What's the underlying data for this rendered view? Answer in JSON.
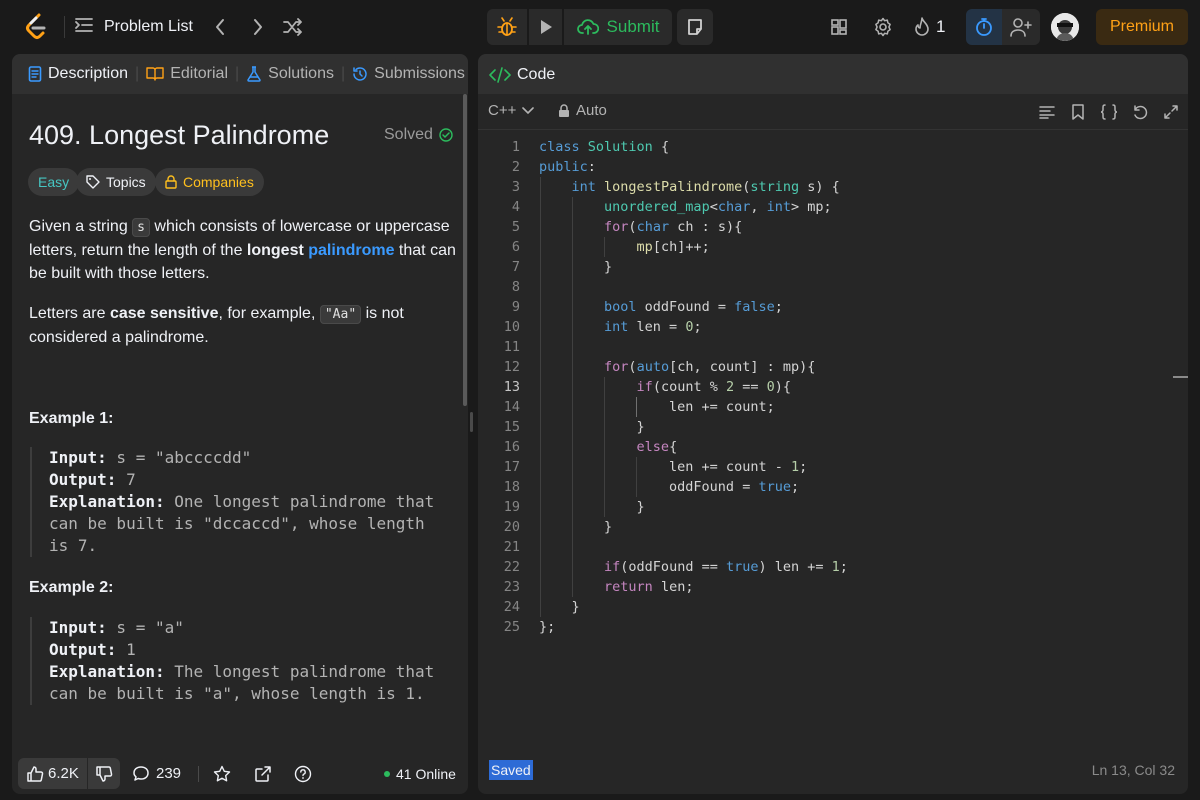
{
  "topbar": {
    "problem_list_label": "Problem List",
    "submit_label": "Submit",
    "streak_count": "1",
    "premium_label": "Premium"
  },
  "left_tabs": [
    "Description",
    "Editorial",
    "Solutions",
    "Submissions"
  ],
  "problem": {
    "title": "409. Longest Palindrome",
    "status": "Solved",
    "difficulty": "Easy",
    "topics_label": "Topics",
    "companies_label": "Companies",
    "para1": {
      "a": "Given a string ",
      "code": "s",
      "b": " which consists of lowercase or uppercase letters, return the length of the ",
      "bold": "longest",
      "link": "palindrome",
      "c": " that can be built with those letters."
    },
    "para2": {
      "a": "Letters are ",
      "bold": "case sensitive",
      "b": ", for example, ",
      "code": "\"Aa\"",
      "c": " is not considered a palindrome."
    },
    "examples": [
      {
        "heading": "Example 1:",
        "input_label": "Input:",
        "input": " s = \"abccccdd\"",
        "output_label": "Output:",
        "output": " 7",
        "explanation_label": "Explanation:",
        "explanation": " One longest palindrome that can be built is \"dccaccd\", whose length is 7."
      },
      {
        "heading": "Example 2:",
        "input_label": "Input:",
        "input": " s = \"a\"",
        "output_label": "Output:",
        "output": " 1",
        "explanation_label": "Explanation:",
        "explanation": " The longest palindrome that can be built is \"a\", whose length is 1."
      }
    ]
  },
  "footer": {
    "likes": "6.2K",
    "comments": "239",
    "online": "41 Online"
  },
  "editor": {
    "panel_title": "Code",
    "language": "C++",
    "mode": "Auto",
    "current_line": 13,
    "lines": [
      [
        [
          "kw",
          "class"
        ],
        [
          "t",
          " "
        ],
        [
          "type",
          "Solution"
        ],
        [
          "t",
          " {"
        ]
      ],
      [
        [
          "kw",
          "public"
        ],
        [
          "t",
          ":"
        ]
      ],
      [
        [
          "t",
          "    "
        ],
        [
          "kw",
          "int"
        ],
        [
          "t",
          " "
        ],
        [
          "fn",
          "longestPalindrome"
        ],
        [
          "t",
          "("
        ],
        [
          "type",
          "string"
        ],
        [
          "t",
          " s) {"
        ]
      ],
      [
        [
          "t",
          "        "
        ],
        [
          "type",
          "unordered_map"
        ],
        [
          "t",
          "<"
        ],
        [
          "kw",
          "char"
        ],
        [
          "t",
          ", "
        ],
        [
          "kw",
          "int"
        ],
        [
          "t",
          "> mp;"
        ]
      ],
      [
        [
          "t",
          "        "
        ],
        [
          "ctl",
          "for"
        ],
        [
          "t",
          "("
        ],
        [
          "kw",
          "char"
        ],
        [
          "t",
          " ch : s){"
        ]
      ],
      [
        [
          "t",
          "            "
        ],
        [
          "fn",
          "mp"
        ],
        [
          "t",
          "[ch]++;"
        ]
      ],
      [
        [
          "t",
          "        }"
        ]
      ],
      [
        [
          "t",
          ""
        ]
      ],
      [
        [
          "t",
          "        "
        ],
        [
          "kw",
          "bool"
        ],
        [
          "t",
          " oddFound = "
        ],
        [
          "kw",
          "false"
        ],
        [
          "t",
          ";"
        ]
      ],
      [
        [
          "t",
          "        "
        ],
        [
          "kw",
          "int"
        ],
        [
          "t",
          " len = "
        ],
        [
          "num",
          "0"
        ],
        [
          "t",
          ";"
        ]
      ],
      [
        [
          "t",
          ""
        ]
      ],
      [
        [
          "t",
          "        "
        ],
        [
          "ctl",
          "for"
        ],
        [
          "t",
          "("
        ],
        [
          "kw",
          "auto"
        ],
        [
          "t",
          "[ch, count] : mp){"
        ]
      ],
      [
        [
          "t",
          "            "
        ],
        [
          "ctl",
          "if"
        ],
        [
          "t",
          "(count % "
        ],
        [
          "num",
          "2"
        ],
        [
          "t",
          " == "
        ],
        [
          "num",
          "0"
        ],
        [
          "t",
          "){"
        ]
      ],
      [
        [
          "t",
          "                len += count;"
        ]
      ],
      [
        [
          "t",
          "            }"
        ]
      ],
      [
        [
          "t",
          "            "
        ],
        [
          "ctl",
          "else"
        ],
        [
          "t",
          "{"
        ]
      ],
      [
        [
          "t",
          "                len += count - "
        ],
        [
          "num",
          "1"
        ],
        [
          "t",
          ";"
        ]
      ],
      [
        [
          "t",
          "                oddFound = "
        ],
        [
          "kw",
          "true"
        ],
        [
          "t",
          ";"
        ]
      ],
      [
        [
          "t",
          "            }"
        ]
      ],
      [
        [
          "t",
          "        }"
        ]
      ],
      [
        [
          "t",
          ""
        ]
      ],
      [
        [
          "t",
          "        "
        ],
        [
          "ctl",
          "if"
        ],
        [
          "t",
          "(oddFound == "
        ],
        [
          "kw",
          "true"
        ],
        [
          "t",
          ") len += "
        ],
        [
          "num",
          "1"
        ],
        [
          "t",
          ";"
        ]
      ],
      [
        [
          "t",
          "        "
        ],
        [
          "ctl",
          "return"
        ],
        [
          "t",
          " len;"
        ]
      ],
      [
        [
          "t",
          "    }"
        ]
      ],
      [
        [
          "t",
          "};"
        ]
      ]
    ]
  },
  "status": {
    "saved": "Saved",
    "cursor": "Ln 13, Col 32"
  },
  "colors": {
    "accent_orange": "#ffa116",
    "submit_green": "#2cbb5d",
    "easy_teal": "#46c6c2",
    "link_blue": "#3a9aff"
  }
}
